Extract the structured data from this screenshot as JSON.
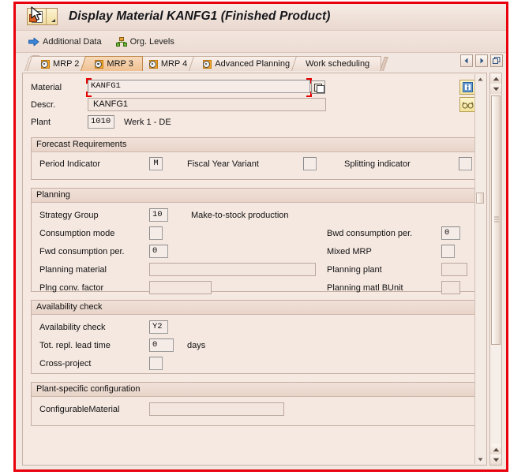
{
  "window": {
    "title": "Display Material KANFG1 (Finished Product)",
    "icon": "material-document-icon"
  },
  "toolbar": {
    "items": [
      {
        "label": "Additional Data",
        "icon": "blue-arrow-right-icon"
      },
      {
        "label": "Org. Levels",
        "icon": "org-levels-icon"
      }
    ]
  },
  "tabs": {
    "items": [
      {
        "label": "MRP 2",
        "active": false,
        "icon": "tab-disc-icon"
      },
      {
        "label": "MRP 3",
        "active": true,
        "icon": "tab-disc-icon"
      },
      {
        "label": "MRP 4",
        "active": false,
        "icon": "tab-disc-icon"
      },
      {
        "label": "Advanced Planning",
        "active": false,
        "icon": "tab-disc-icon"
      },
      {
        "label": "Work scheduling",
        "active": false,
        "icon": null
      }
    ],
    "nav": {
      "prev": "scroll-tabs-left-icon",
      "next": "scroll-tabs-right-icon",
      "list": "tab-list-icon"
    }
  },
  "header": {
    "material_label": "Material",
    "material_value": "KANFG1",
    "material_matchcode": "matchcode-icon",
    "descr_label": "Descr.",
    "descr_value": "KANFG1",
    "plant_label": "Plant",
    "plant_value": "1010",
    "plant_text": "Werk 1 - DE",
    "side_buttons": [
      {
        "name": "info-button",
        "icon": "info-icon"
      },
      {
        "name": "display-glasses-button",
        "icon": "glasses-icon"
      }
    ]
  },
  "sections": {
    "forecast": {
      "title": "Forecast Requirements",
      "period_indicator_label": "Period Indicator",
      "period_indicator_value": "M",
      "fiscal_year_variant_label": "Fiscal Year Variant",
      "fiscal_year_variant_value": "",
      "splitting_indicator_label": "Splitting indicator",
      "splitting_indicator_value": ""
    },
    "planning": {
      "title": "Planning",
      "strategy_group_label": "Strategy Group",
      "strategy_group_value": "10",
      "strategy_group_text": "Make-to-stock production",
      "consumption_mode_label": "Consumption mode",
      "consumption_mode_value": "",
      "bwd_consumption_label": "Bwd consumption per.",
      "bwd_consumption_value": "0",
      "fwd_consumption_label": "Fwd consumption per.",
      "fwd_consumption_value": "0",
      "mixed_mrp_label": "Mixed MRP",
      "mixed_mrp_value": "",
      "planning_material_label": "Planning material",
      "planning_material_value": "",
      "planning_plant_label": "Planning plant",
      "planning_plant_value": "",
      "plng_conv_factor_label": "Plng conv. factor",
      "plng_conv_factor_value": "",
      "planning_matl_bunit_label": "Planning matl BUnit",
      "planning_matl_bunit_value": ""
    },
    "availability": {
      "title": "Availability check",
      "availability_check_label": "Availability check",
      "availability_check_value": "Y2",
      "tot_repl_lead_time_label": "Tot. repl. lead time",
      "tot_repl_lead_time_value": "0",
      "tot_repl_lead_time_unit": "days",
      "cross_project_label": "Cross-project",
      "cross_project_value": ""
    },
    "plant_config": {
      "title": "Plant-specific configuration",
      "configurable_material_label": "ConfigurableMaterial",
      "configurable_material_value": ""
    }
  },
  "colors": {
    "accent_frame": "#e8000c",
    "window_bg": "#f2e7e1",
    "active_tab": "#f0c193",
    "field_bg": "#f6ece7"
  }
}
